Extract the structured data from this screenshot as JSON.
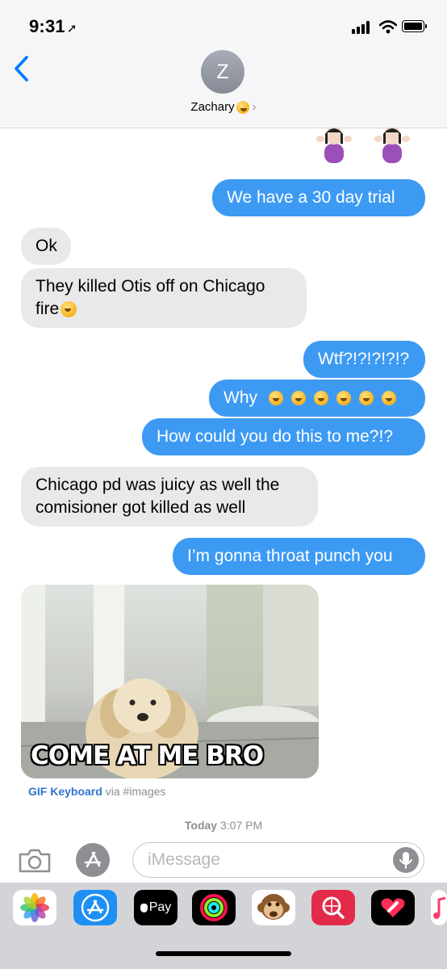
{
  "status_bar": {
    "time": "9:31",
    "location_glyph": "➚"
  },
  "header": {
    "avatar_initial": "Z",
    "contact_name": "Zachary",
    "contact_emoji": "kissing-face-emoji",
    "chevron": "›"
  },
  "messages": [
    {
      "type": "emoji",
      "from": "me",
      "content": "two woman-shrugging emojis"
    },
    {
      "type": "text",
      "from": "me",
      "text": "We have a 30 day trial"
    },
    {
      "type": "text",
      "from": "them",
      "text": "Ok"
    },
    {
      "type": "text",
      "from": "them",
      "line1": "They killed Otis off on Chicago",
      "line2": "fire"
    },
    {
      "type": "text",
      "from": "me",
      "text": "Wtf?!?!?!?!?"
    },
    {
      "type": "text",
      "from": "me",
      "text": "Why",
      "emoji_count": 6,
      "emoji": "weary-face"
    },
    {
      "type": "text",
      "from": "me",
      "text": "How could you do this to me?!?"
    },
    {
      "type": "text",
      "from": "them",
      "line1": "Chicago pd was juicy as well the",
      "line2": "comisioner got killed as well"
    },
    {
      "type": "text",
      "from": "me",
      "text": "I’m gonna throat punch you"
    },
    {
      "type": "gif",
      "from": "them",
      "caption": "COME AT ME BRO"
    }
  ],
  "gif_source": {
    "app": "GIF Keyboard",
    "via": "via #images"
  },
  "timestamp": {
    "day": "Today",
    "time": "3:07 PM"
  },
  "input_bar": {
    "placeholder": "iMessage"
  },
  "app_drawer": {
    "apps": [
      "photos-app",
      "app-store-app",
      "apple-pay-app",
      "activity-app",
      "animoji-app",
      "search-images-app",
      "digital-touch-app",
      "music-app"
    ],
    "apple_pay_label": "Pay"
  },
  "colors": {
    "sent_bubble": "#3d9af3",
    "received_bubble": "#e9e9eb",
    "link_blue": "#2f74d0",
    "accent_blue": "#007aff"
  }
}
